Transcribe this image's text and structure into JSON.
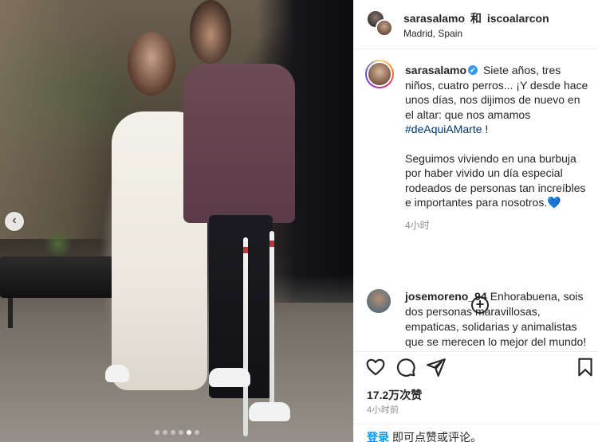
{
  "post": {
    "user_primary": "sarasalamo",
    "conjunction": "和",
    "user_secondary": "iscoalarcon",
    "location": "Madrid, Spain"
  },
  "caption": {
    "user": "sarasalamo",
    "verified_mark": "✔",
    "text_part1": "Siete años, tres niños, cuatro perros... ¡Y desde hace unos días, nos dijimos de nuevo en el altar: que nos amamos",
    "hashtag": "#deAquiAMarte",
    "text_part1_end": "!",
    "text_part2": "Seguimos viviendo en una burbuja por haber vivido un día especial rodeados de personas tan increíbles e importantes para nosotros.",
    "heart_emoji": "💙",
    "time": "4小时"
  },
  "comment": {
    "user": "josemoreno_94",
    "text": "Enhorabuena, sois dos personas maravillosas, empaticas, solidarias y animalistas que se merecen lo mejor del mundo!"
  },
  "more_comments_symbol": "+",
  "carousel": {
    "prev_symbol": "‹",
    "slide_count": 6,
    "active_index": 4
  },
  "likes": "17.2万次赞",
  "posted_time": "4小时前",
  "footer": {
    "login_label": "登录",
    "rest_text": "即可点赞或评论。"
  },
  "icons": [
    "heart-icon",
    "comment-icon",
    "share-icon",
    "bookmark-icon"
  ]
}
